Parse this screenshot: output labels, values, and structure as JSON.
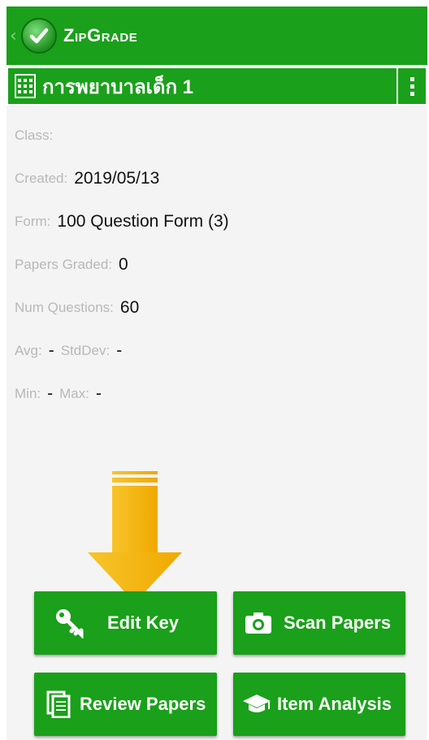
{
  "app": {
    "back_icon": "chevron-left-icon",
    "logo_icon": "checkmark-badge-icon",
    "title": "ZipGrade"
  },
  "quiz": {
    "title": "การพยาบาลเด็ก 1",
    "icon": "form-grid-icon",
    "menu_icon": "overflow-menu-icon"
  },
  "info": {
    "class_label": "Class:",
    "class_value": "",
    "created_label": "Created:",
    "created_value": "2019/05/13",
    "form_label": "Form:",
    "form_value": "100 Question Form (3)",
    "graded_label": "Papers Graded:",
    "graded_value": "0",
    "numq_label": "Num Questions:",
    "numq_value": "60",
    "avg_label": "Avg:",
    "avg_value": "-",
    "std_label": "StdDev:",
    "std_value": "-",
    "min_label": "Min:",
    "min_value": "-",
    "max_label": "Max:",
    "max_value": "-"
  },
  "buttons": {
    "edit_key": "Edit Key",
    "scan_papers": "Scan Papers",
    "review_papers": "Review Papers",
    "item_analysis": "Item Analysis"
  },
  "colors": {
    "primary": "#1aa01a",
    "background": "#f4f4f4",
    "arrow": "#f5b800"
  }
}
